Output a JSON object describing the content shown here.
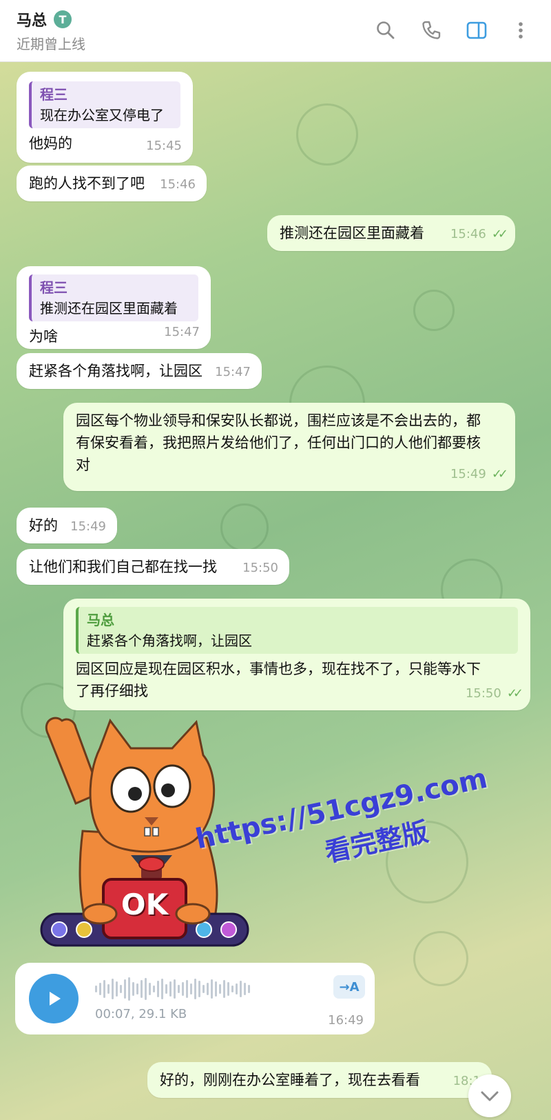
{
  "header": {
    "title": "马总",
    "badge": "T",
    "status": "近期曾上线"
  },
  "messages": [
    {
      "reply_name": "程三",
      "reply_text": "现在办公室又停电了",
      "text": "他妈的",
      "time": "15:45"
    },
    {
      "text": "跑的人找不到了吧",
      "time": "15:46"
    },
    {
      "text": "推测还在园区里面藏着",
      "time": "15:46"
    },
    {
      "reply_name": "程三",
      "reply_text": "推测还在园区里面藏着",
      "text": "为啥",
      "time": "15:47"
    },
    {
      "text": "赶紧各个角落找啊，让园区",
      "time": "15:47"
    },
    {
      "line1": "园区每个物业领导和保安队长都说，围栏应该是不会出去的，都",
      "line2": "有保安看着，我把照片发给他们了，任何出门口的人他们都要核",
      "line3": "对",
      "time": "15:49"
    },
    {
      "text": "好的",
      "time": "15:49"
    },
    {
      "text": "让他们和我们自己都在找一找",
      "time": "15:50"
    },
    {
      "reply_name": "马总",
      "reply_text": "赶紧各个角落找啊，让园区",
      "line1": "园区回应是现在园区积水，事情也多，现在找不了，只能等水下",
      "line2": "了再仔细找",
      "time": "15:50"
    },
    {
      "text": "好的，刚刚在办公室睡着了，现在去看看",
      "time": "18:1"
    }
  ],
  "sticker": {
    "label": "OK"
  },
  "voice": {
    "info": "00:07, 29.1 KB",
    "time": "16:49",
    "transcribe": "→A"
  },
  "watermark": {
    "line1": "https://51cgz9.com",
    "line2": "看完整版"
  },
  "colors": {
    "accent": "#3e9de0",
    "incoming": "#ffffff",
    "outgoing": "#effdde",
    "reply_purple": "#8a58bd",
    "reply_green": "#5ba84a"
  }
}
